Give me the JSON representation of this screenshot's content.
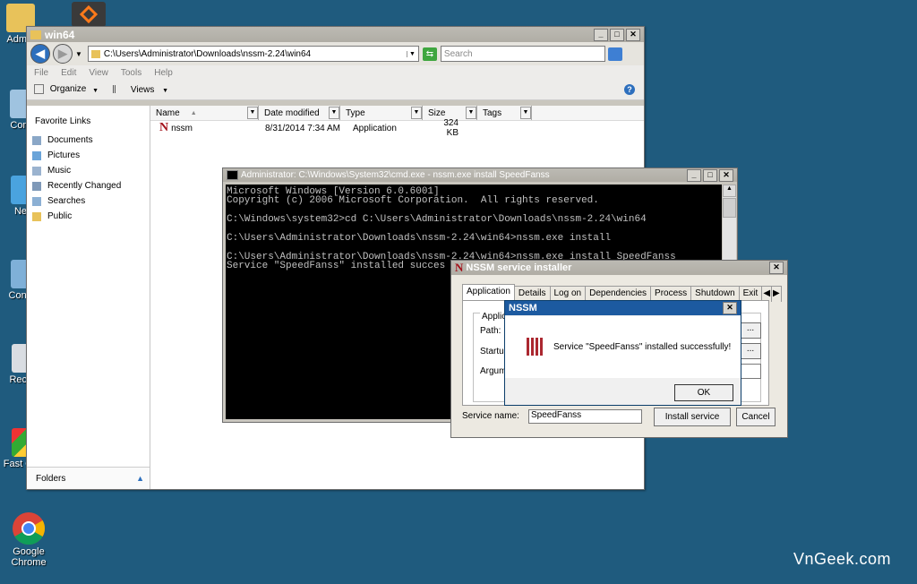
{
  "desktop": {
    "icons": [
      {
        "label": "Admin"
      },
      {
        "label": "Com"
      },
      {
        "label": "Ne"
      },
      {
        "label": "Contr"
      },
      {
        "label": "Recy"
      },
      {
        "label": "Fast Ca"
      },
      {
        "label": "Google Chrome"
      }
    ],
    "watermark": "VnGeek.com"
  },
  "explorer": {
    "title": "win64",
    "address": "C:\\Users\\Administrator\\Downloads\\nssm-2.24\\win64",
    "search_placeholder": "Search",
    "menu": [
      "File",
      "Edit",
      "View",
      "Tools",
      "Help"
    ],
    "toolbar": {
      "organize": "Organize",
      "views": "Views"
    },
    "favorite_links_header": "Favorite Links",
    "nav_items": [
      "Documents",
      "Pictures",
      "Music",
      "Recently Changed",
      "Searches",
      "Public"
    ],
    "folders_label": "Folders",
    "columns": [
      "Name",
      "Date modified",
      "Type",
      "Size",
      "Tags"
    ],
    "files": [
      {
        "name": "nssm",
        "date": "8/31/2014 7:34 AM",
        "type": "Application",
        "size": "324 KB"
      }
    ]
  },
  "cmd": {
    "title": "Administrator: C:\\Windows\\System32\\cmd.exe - nssm.exe  install SpeedFanss",
    "lines": [
      "Microsoft Windows [Version 6.0.6001]",
      "Copyright (c) 2006 Microsoft Corporation.  All rights reserved.",
      "",
      "C:\\Windows\\system32>cd C:\\Users\\Administrator\\Downloads\\nssm-2.24\\win64",
      "",
      "C:\\Users\\Administrator\\Downloads\\nssm-2.24\\win64>nssm.exe install",
      "",
      "C:\\Users\\Administrator\\Downloads\\nssm-2.24\\win64>nssm.exe install SpeedFanss",
      "Service \"SpeedFanss\" installed succes"
    ]
  },
  "nssm": {
    "title": "NSSM service installer",
    "tabs": [
      "Application",
      "Details",
      "Log on",
      "Dependencies",
      "Process",
      "Shutdown",
      "Exit"
    ],
    "group_label": "Applic",
    "path_label": "Path:",
    "startup_label": "Startup",
    "args_label": "Argum",
    "browse": "...",
    "service_name_label": "Service name:",
    "service_name_value": "SpeedFanss",
    "install_button": "Install service",
    "cancel_button": "Cancel"
  },
  "msgbox": {
    "title": "NSSM",
    "message": "Service \"SpeedFanss\" installed successfully!",
    "ok": "OK"
  }
}
